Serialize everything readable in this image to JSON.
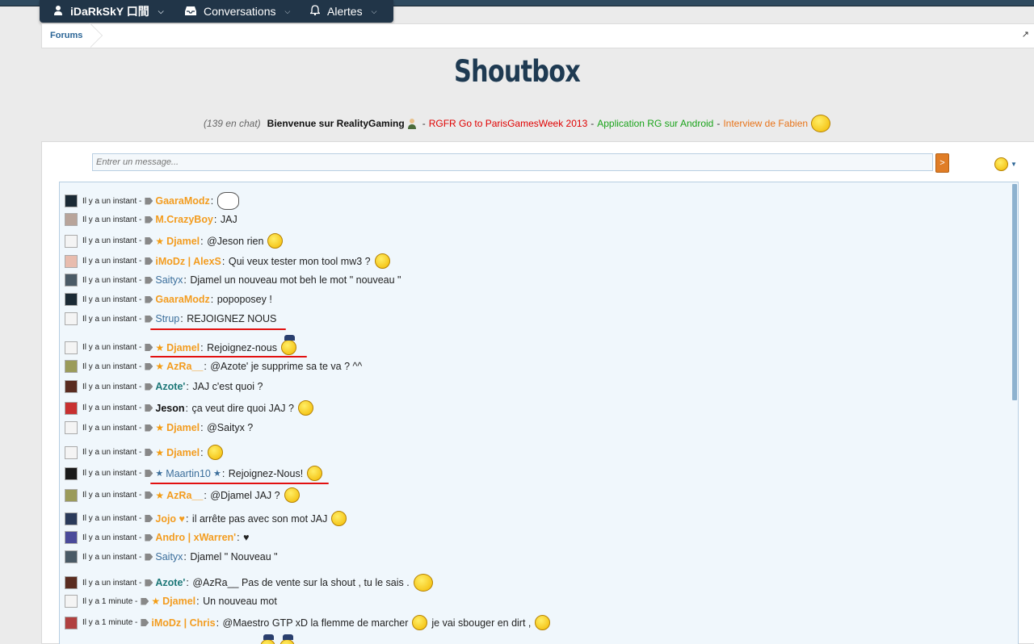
{
  "nav": {
    "user": "iDaRkSkY 口間",
    "conversations": "Conversations",
    "alerts": "Alertes"
  },
  "breadcrumb": {
    "forums": "Forums"
  },
  "page": {
    "title": "Shoutbox"
  },
  "notice": {
    "count": "(139 en chat)",
    "welcome": "Bienvenue sur RealityGaming",
    "sep": "-",
    "link1": "RGFR Go to ParisGamesWeek 2013",
    "link2": "Application RG sur Android",
    "link3": "Interview de Fabien"
  },
  "input": {
    "placeholder": "Entrer un message...",
    "send_label": ">"
  },
  "messages": [
    {
      "time": "Il y a un instant -",
      "user": "GaaraModz",
      "text": ""
    },
    {
      "time": "Il y a un instant -",
      "user": "M.CrazyBoy",
      "text": "JAJ"
    },
    {
      "time": "Il y a un instant -",
      "user": "Djamel",
      "text": "@Jeson rien"
    },
    {
      "time": "Il y a un instant -",
      "user": "iMoDz | AlexS",
      "text": "Qui veux tester mon tool mw3 ?"
    },
    {
      "time": "Il y a un instant -",
      "user": "Saityx",
      "text": "Djamel un nouveau mot beh le mot \" nouveau \""
    },
    {
      "time": "Il y a un instant -",
      "user": "GaaraModz",
      "text": "popoposey !"
    },
    {
      "time": "Il y a un instant -",
      "user": "Strup",
      "text": "REJOIGNEZ NOUS"
    },
    {
      "time": "Il y a un instant -",
      "user": "Djamel",
      "text": "Rejoignez-nous"
    },
    {
      "time": "Il y a un instant -",
      "user": "AzRa__",
      "text": "@Azote' je supprime sa te va ? ^^"
    },
    {
      "time": "Il y a un instant -",
      "user": "Azote'",
      "text": "JAJ c'est quoi ?"
    },
    {
      "time": "Il y a un instant -",
      "user": "Jeson",
      "text": "ça veut dire quoi JAJ ?"
    },
    {
      "time": "Il y a un instant -",
      "user": "Djamel",
      "text": "@Saityx ?"
    },
    {
      "time": "Il y a un instant -",
      "user": "Djamel",
      "text": ""
    },
    {
      "time": "Il y a un instant -",
      "user": "Maartin10",
      "text": "Rejoignez-Nous!"
    },
    {
      "time": "Il y a un instant -",
      "user": "AzRa__",
      "text": "@Djamel JAJ ?"
    },
    {
      "time": "Il y a un instant -",
      "user": "Jojo ♥",
      "text": "il arrête pas avec son mot JAJ"
    },
    {
      "time": "Il y a un instant -",
      "user": "Andro | xWarren'",
      "text": "♥"
    },
    {
      "time": "Il y a un instant -",
      "user": "Saityx",
      "text": "Djamel \" Nouveau \""
    },
    {
      "time": "Il y a un instant -",
      "user": "Azote'",
      "text": "@AzRa__ Pas de vente sur la shout , tu le sais ."
    },
    {
      "time": "Il y a 1 minute -",
      "user": "Djamel",
      "text": "Un nouveau mot"
    },
    {
      "time": "Il y a 1 minute -",
      "user": "iMoDz | Chris",
      "text": "@Maestro GTP xD la flemme de marcher"
    }
  ],
  "extra_text": {
    "chris_tail": "je vai sbouger en dirt ,"
  },
  "colors": {
    "accent_orange": "#f39c1f",
    "link_blue": "#3b6e9b",
    "nav_bg": "#213548",
    "underline_red": "#e21010"
  }
}
